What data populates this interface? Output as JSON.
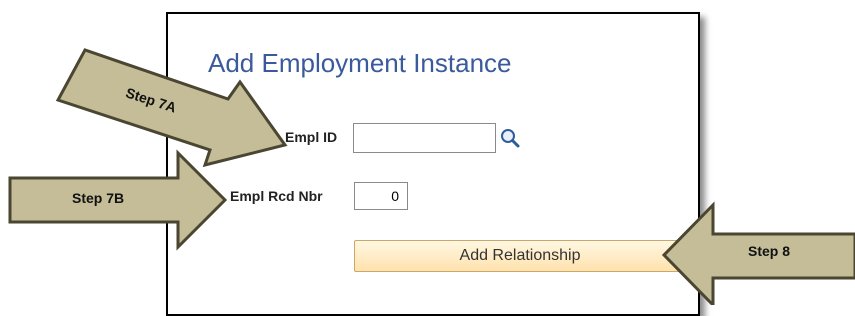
{
  "form": {
    "title": "Add Employment Instance",
    "empl_id_label": "Empl ID",
    "empl_id_value": "",
    "empl_rcd_label": "Empl Rcd Nbr",
    "empl_rcd_value": "0",
    "search_icon": "magnifier-icon",
    "add_button_label": "Add Relationship"
  },
  "annotations": {
    "step_7a": "Step 7A",
    "step_7b": "Step 7B",
    "step_8": "Step 8",
    "arrow_color": "#c4bd97",
    "arrow_border": "#4a4631"
  },
  "colors": {
    "title": "#3a5a9c",
    "button_top": "#fff7e2",
    "button_bottom": "#ffe2ad"
  }
}
